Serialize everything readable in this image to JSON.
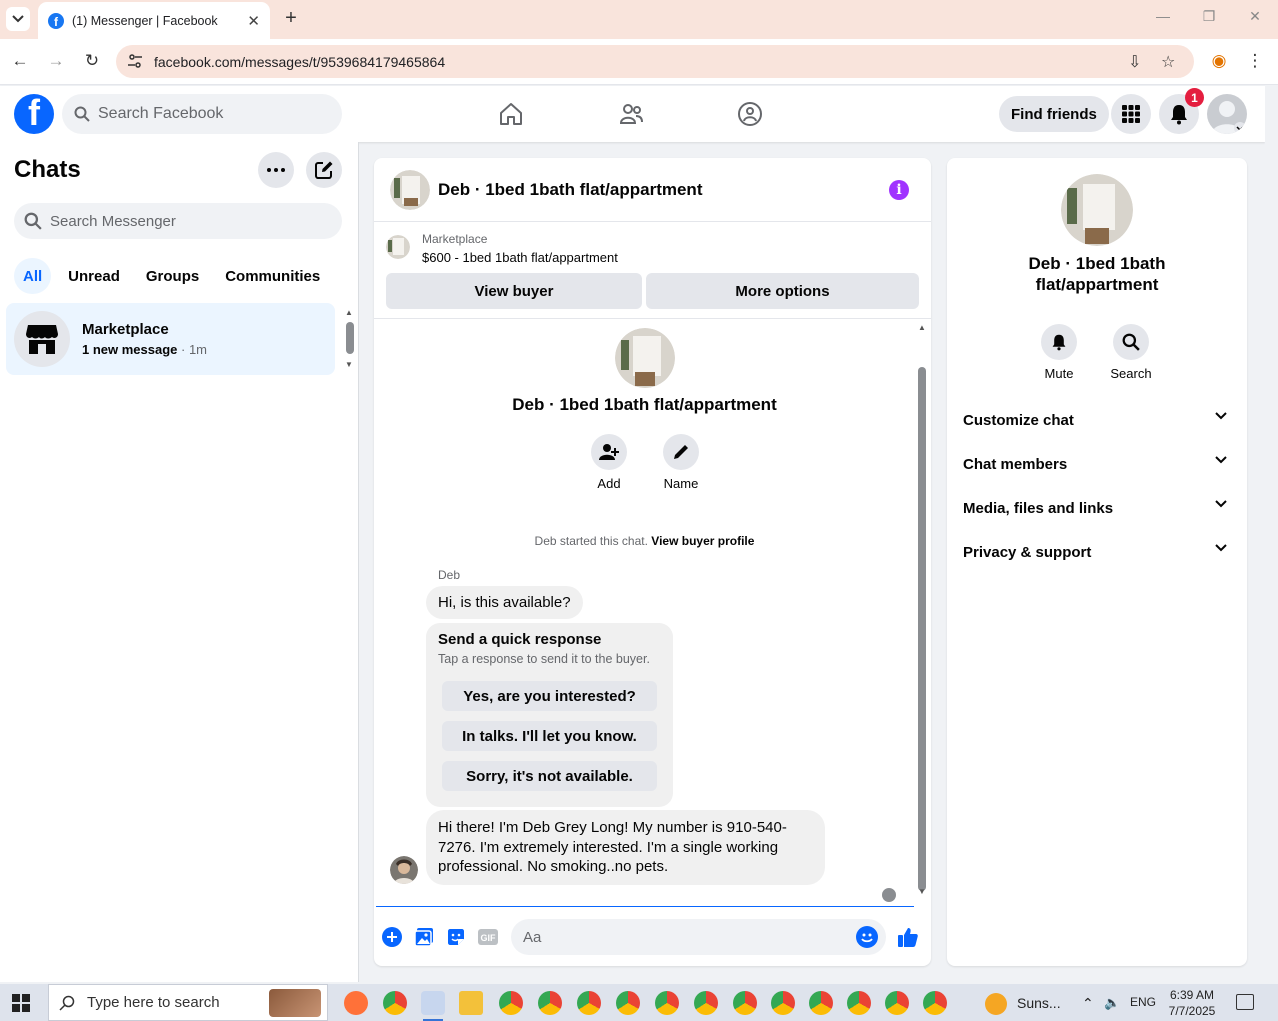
{
  "browser": {
    "tab_title": "(1) Messenger | Facebook",
    "url": "facebook.com/messages/t/9539684179465864"
  },
  "header": {
    "search_placeholder": "Search Facebook",
    "find_friends": "Find friends",
    "notification_count": "1"
  },
  "sidebar": {
    "title": "Chats",
    "search_placeholder": "Search Messenger",
    "filters": [
      "All",
      "Unread",
      "Groups",
      "Communities"
    ],
    "active_filter": "All",
    "chats": [
      {
        "name": "Marketplace",
        "snippet_bold": "1 new message",
        "time": " · 1m"
      }
    ]
  },
  "conversation": {
    "title": "Deb · 1bed 1bath flat/appartment",
    "marketplace_label": "Marketplace",
    "listing": "$600 - 1bed 1bath flat/appartment",
    "view_buyer": "View buyer",
    "more_options": "More options",
    "profile_name": "Deb · 1bed 1bath flat/appartment",
    "add_label": "Add",
    "name_label": "Name",
    "started_text": "Deb started this chat. ",
    "view_buyer_profile": "View buyer profile",
    "sender": "Deb",
    "message1": "Hi, is this available?",
    "quick_title": "Send a quick response",
    "quick_subtitle": "Tap a response to send it to the buyer.",
    "quick_responses": [
      "Yes, are you interested?",
      "In talks. I'll let you know.",
      "Sorry, it's not available."
    ],
    "message2": "Hi there! I'm Deb Grey Long! My number is 910-540-7276. I'm extremely interested. I'm a single working professional. No smoking..no pets.",
    "composer_placeholder": "Aa"
  },
  "details": {
    "name": "Deb · 1bed 1bath flat/appartment",
    "mute": "Mute",
    "search": "Search",
    "sections": [
      "Customize chat",
      "Chat members",
      "Media, files and links",
      "Privacy & support"
    ]
  },
  "taskbar": {
    "search_placeholder": "Type here to search",
    "weather": "Suns...",
    "language": "ENG",
    "time": "6:39 AM",
    "date": "7/7/2025"
  },
  "colors": {
    "brand": "#0866ff",
    "accent_purple": "#a033ff",
    "badge_red": "#e41e3f"
  }
}
